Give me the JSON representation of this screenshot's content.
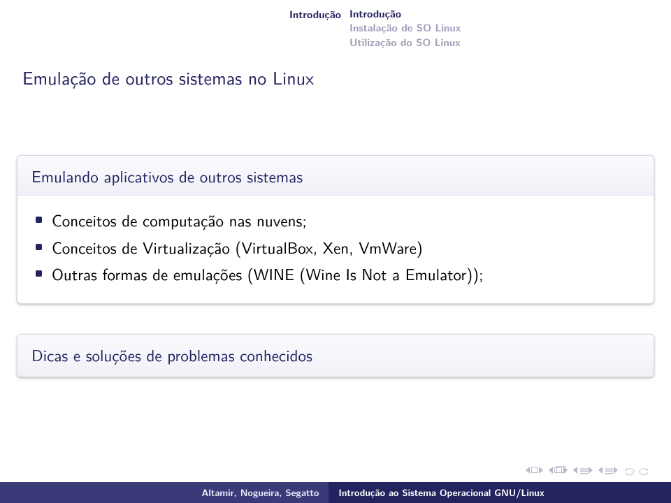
{
  "header": {
    "left": "Introdução",
    "right": {
      "line1": "Introdução",
      "line2": "Instalação de SO Linux",
      "line3": "Utilização do SO Linux"
    }
  },
  "slide_title": "Emulação de outros sistemas no Linux",
  "block1": {
    "title": "Emulando aplicativos de outros sistemas",
    "items": [
      "Conceitos de computação nas nuvens;",
      "Conceitos de Virtualização (VirtualBox, Xen, VmWare)",
      "Outras formas de emulações (WINE (Wine Is Not a Emulator));"
    ]
  },
  "block2": {
    "title": "Dicas e soluções de problemas conhecidos"
  },
  "footer": {
    "left": "Altamir, Nogueira, Segatto",
    "right": "Introdução ao Sistema Operacional GNU/Linux"
  }
}
